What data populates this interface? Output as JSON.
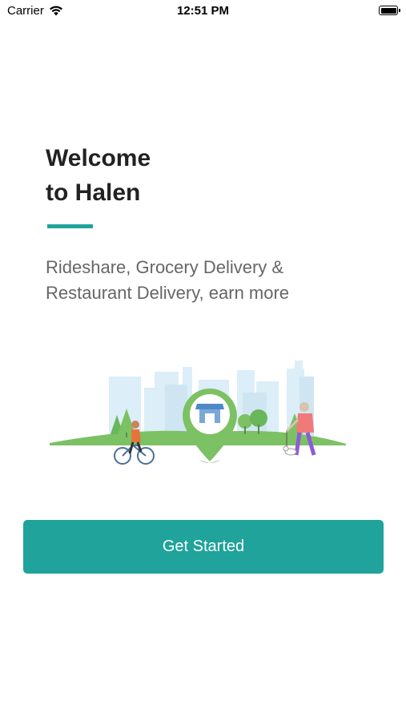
{
  "status_bar": {
    "carrier": "Carrier",
    "time": "12:51 PM",
    "icons": [
      "wifi-icon",
      "battery-icon"
    ]
  },
  "welcome": {
    "title_line1": "Welcome",
    "title_line2": "to Halen",
    "subtitle_line1": "Rideshare, Grocery Delivery &",
    "subtitle_line2": "Restaurant Delivery, earn more"
  },
  "illustration": {
    "icon": "city-storefront-illustration"
  },
  "cta": {
    "label": "Get Started"
  },
  "colors": {
    "accent": "#1fa39a",
    "title": "#222222",
    "subtitle": "#666666"
  }
}
